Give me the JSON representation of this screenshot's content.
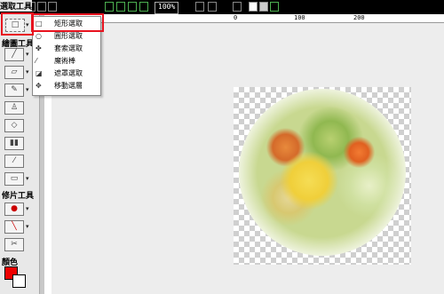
{
  "toolbar": {
    "zoom": "100%",
    "icons": [
      "undo-icon",
      "redo-icon",
      "copy-icon",
      "paste-icon",
      "image-icon",
      "zoom-in-icon",
      "zoom-out-icon",
      "fit-icon",
      "actual-size-icon",
      "pointer-icon",
      "hand-icon",
      "ruler-icon",
      "color-square-icon",
      "color-square2-icon",
      "add-icon"
    ]
  },
  "left_panel": {
    "select_title": "選取工具",
    "paint_title": "繪圖工具",
    "edit_title": "修片工具",
    "color_title": "顏色",
    "colors": {
      "foreground": "#ee0000",
      "background": "#ffffff"
    }
  },
  "dropdown": {
    "items": [
      {
        "label": "矩形選取",
        "icon": "rect-select-icon"
      },
      {
        "label": "圓形選取",
        "icon": "ellipse-select-icon"
      },
      {
        "label": "套索選取",
        "icon": "lasso-icon"
      },
      {
        "label": "魔術棒",
        "icon": "magic-wand-icon"
      },
      {
        "label": "遮罩選取",
        "icon": "mask-select-icon"
      },
      {
        "label": "移動選層",
        "icon": "move-layer-icon"
      }
    ]
  },
  "ruler": {
    "h_labels": [
      "0",
      "100",
      "200"
    ]
  },
  "highlight_color": "#e8131f"
}
